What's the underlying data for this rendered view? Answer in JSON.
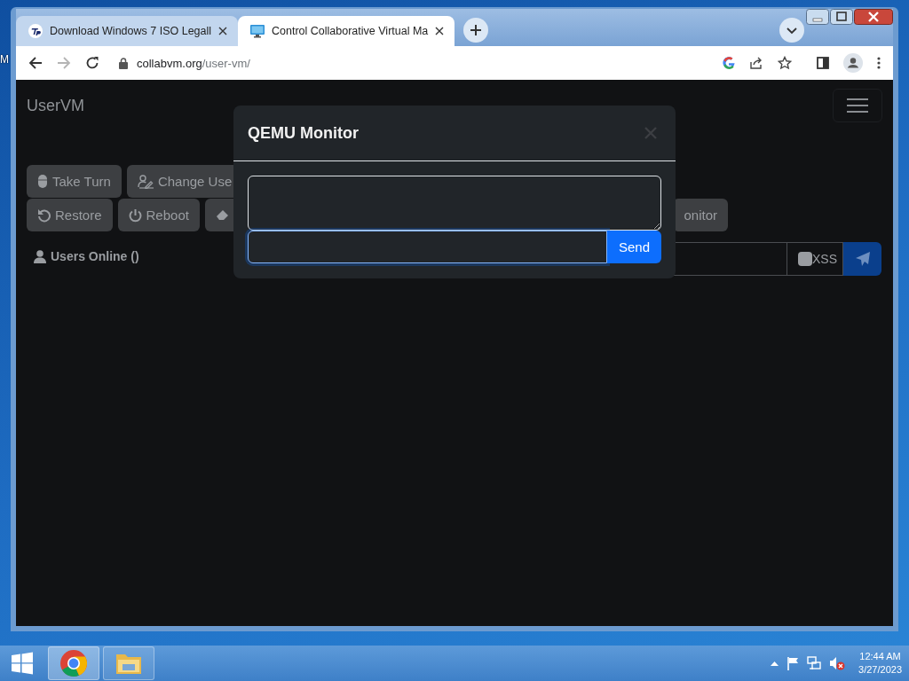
{
  "desktop": {
    "edge_label": "M"
  },
  "browser": {
    "tabs": [
      {
        "title": "Download Windows 7 ISO Legall",
        "selected": false
      },
      {
        "title": "Control Collaborative Virtual Ma",
        "selected": true
      }
    ],
    "forward_disabled": true,
    "address": {
      "domain": "collabvm.org",
      "path": "/user-vm/"
    }
  },
  "page": {
    "brand": "UserVM",
    "button_rows": [
      [
        {
          "label": "Take Turn"
        },
        {
          "label": "Change Use"
        }
      ],
      [
        {
          "label": "Restore"
        },
        {
          "label": "Reboot"
        },
        {},
        {
          "label": "onitor"
        }
      ]
    ],
    "users_online": "Users Online ()",
    "xss": {
      "label": "XSS",
      "checked": false
    }
  },
  "modal": {
    "title": "QEMU Monitor",
    "send": "Send"
  },
  "taskbar": {
    "time": "12:44 AM",
    "date": "3/27/2023"
  }
}
